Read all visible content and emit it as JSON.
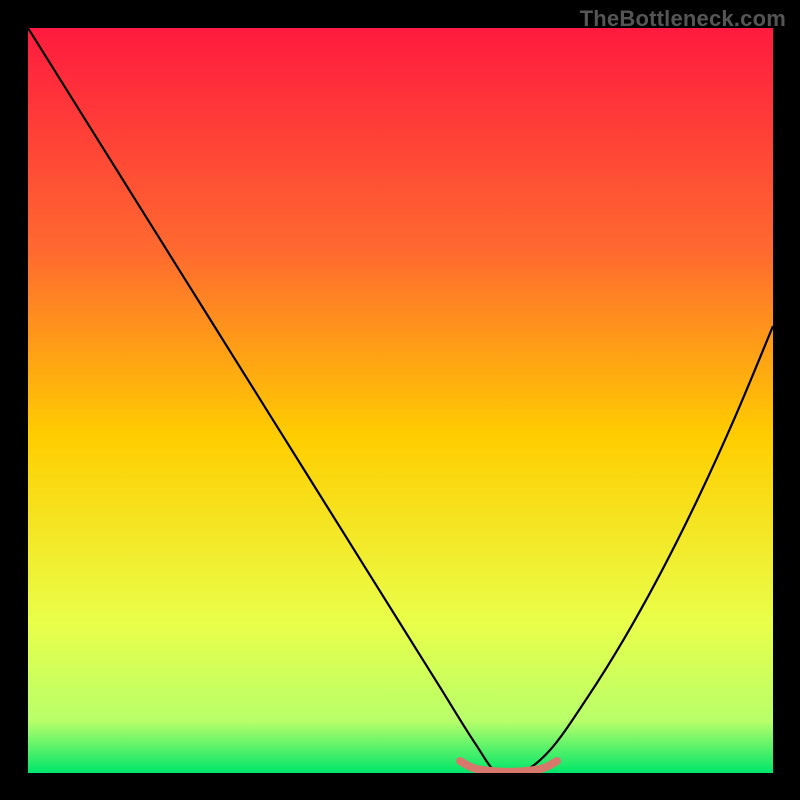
{
  "watermark": "TheBottleneck.com",
  "chart_data": {
    "type": "line",
    "title": "",
    "xlabel": "",
    "ylabel": "",
    "xlim": [
      0,
      100
    ],
    "ylim": [
      0,
      100
    ],
    "grid": false,
    "legend": false,
    "background_gradient_stops": [
      {
        "offset": 0,
        "color": "#ff1a3f"
      },
      {
        "offset": 0.3,
        "color": "#ff6a2f"
      },
      {
        "offset": 0.55,
        "color": "#ffce00"
      },
      {
        "offset": 0.8,
        "color": "#e9ff4a"
      },
      {
        "offset": 0.93,
        "color": "#b8ff6a"
      },
      {
        "offset": 1.0,
        "color": "#00e66a"
      }
    ],
    "series": [
      {
        "name": "bottleneck-curve",
        "color": "#000000",
        "x": [
          0,
          5,
          10,
          15,
          20,
          25,
          30,
          35,
          40,
          45,
          50,
          55,
          60,
          63,
          66,
          70,
          75,
          80,
          85,
          90,
          95,
          100
        ],
        "y": [
          100,
          92,
          84,
          76,
          68,
          60,
          52,
          44,
          36,
          28,
          20,
          12,
          4,
          0,
          0,
          3,
          10,
          18,
          27,
          37,
          48,
          60
        ]
      },
      {
        "name": "optimal-marker",
        "color": "#d8776c",
        "x": [
          58,
          60,
          63,
          66,
          69,
          71
        ],
        "y": [
          1.6,
          0.6,
          0.2,
          0.2,
          0.6,
          1.6
        ]
      }
    ]
  }
}
